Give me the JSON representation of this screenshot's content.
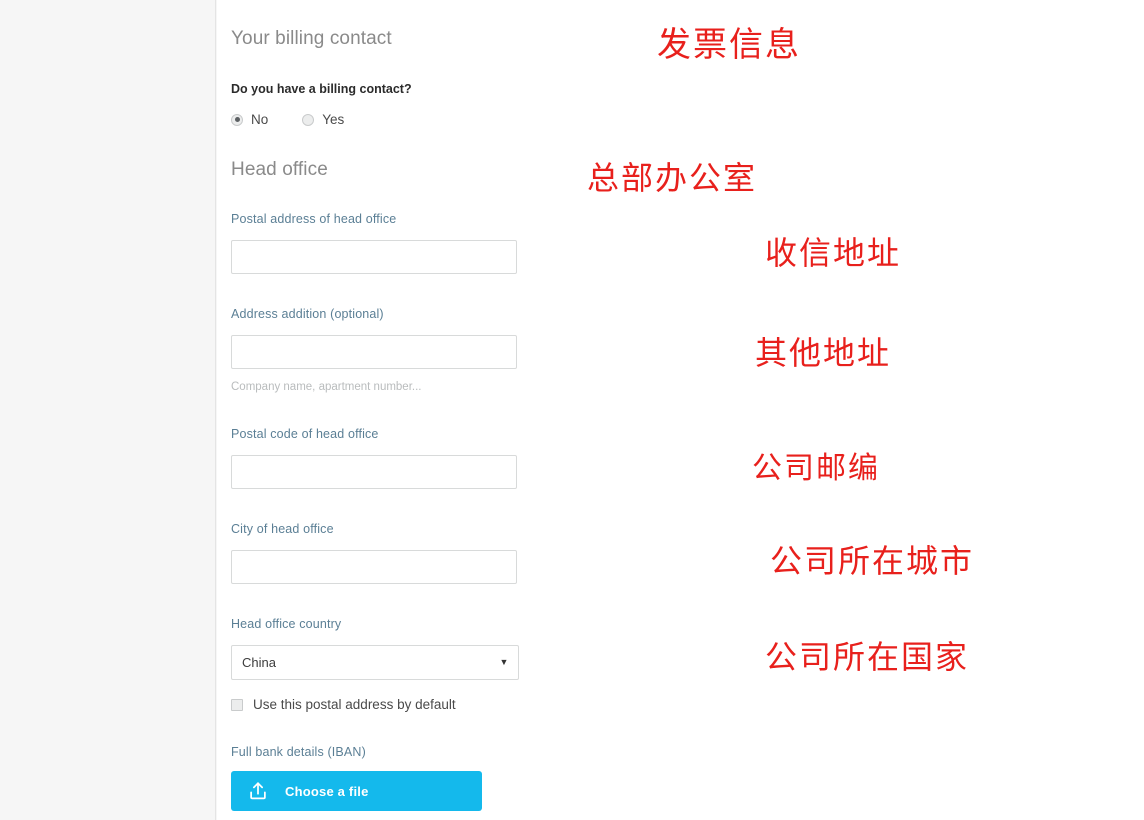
{
  "layout": {
    "accent_color": "#14b9ec",
    "label_color": "#5b7f95",
    "heading_color": "#8a8a8a",
    "annotation_color": "#e8201c",
    "gutter_background": "#f6f6f6",
    "content_background": "#ffffff"
  },
  "billing_section": {
    "heading": "Your billing contact",
    "annotation": "发票信息",
    "question": "Do you have a billing contact?",
    "options": [
      {
        "label": "No",
        "selected": true
      },
      {
        "label": "Yes",
        "selected": false
      }
    ]
  },
  "head_office_section": {
    "heading": "Head office",
    "annotation": "总部办公室",
    "fields": [
      {
        "label": "Postal address of head office",
        "value": "",
        "placeholder": "",
        "annotation": "收信地址"
      },
      {
        "label": "Address addition (optional)",
        "value": "",
        "placeholder": "",
        "helper": "Company name, apartment number...",
        "annotation": "其他地址"
      },
      {
        "label": "Postal code of head office",
        "value": "",
        "placeholder": "",
        "annotation": "公司邮编"
      },
      {
        "label": "City of head office",
        "value": "",
        "placeholder": "",
        "annotation": "公司所在城市"
      }
    ],
    "country": {
      "label": "Head office country",
      "selected": "China",
      "caret_icon": "chevron-down-icon",
      "annotation": "公司所在国家"
    },
    "default_address_checkbox": {
      "label": "Use this postal address by default",
      "checked": false
    },
    "bank_details": {
      "label": "Full bank details (IBAN)",
      "button_label": "Choose a file",
      "button_icon": "upload-icon"
    }
  }
}
